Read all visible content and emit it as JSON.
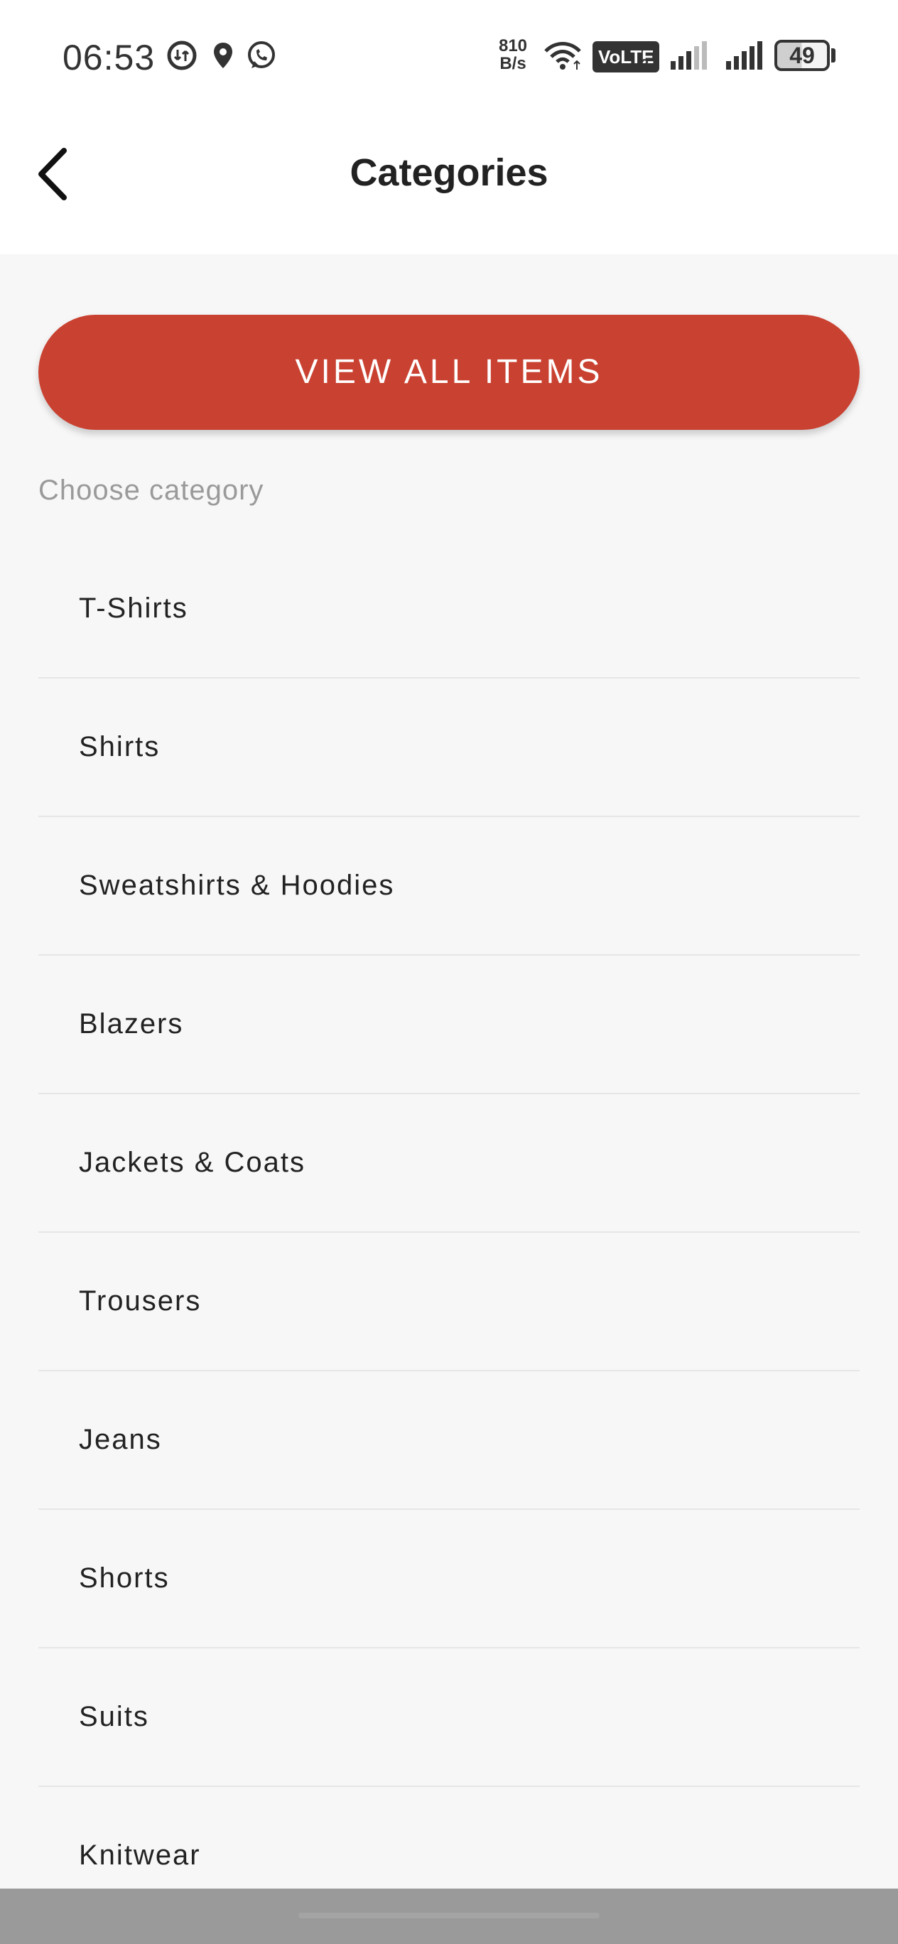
{
  "status_bar": {
    "time": "06:53",
    "net_speed_value": "810",
    "net_speed_unit": "B/s",
    "volte_label": "VoLTE",
    "volte_sim": "2",
    "battery_level": "49"
  },
  "header": {
    "title": "Categories",
    "back_icon": "chevron-left-icon"
  },
  "main": {
    "view_all_label": "VIEW ALL ITEMS",
    "section_label": "Choose category",
    "categories": [
      {
        "label": "T-Shirts"
      },
      {
        "label": "Shirts"
      },
      {
        "label": "Sweatshirts & Hoodies"
      },
      {
        "label": "Blazers"
      },
      {
        "label": "Jackets & Coats"
      },
      {
        "label": "Trousers"
      },
      {
        "label": "Jeans"
      },
      {
        "label": "Shorts"
      },
      {
        "label": "Suits"
      },
      {
        "label": "Knitwear"
      }
    ]
  },
  "colors": {
    "accent": "#c94131",
    "background": "#f7f7f7",
    "header_background": "#ffffff",
    "divider": "#e6e6e6"
  }
}
